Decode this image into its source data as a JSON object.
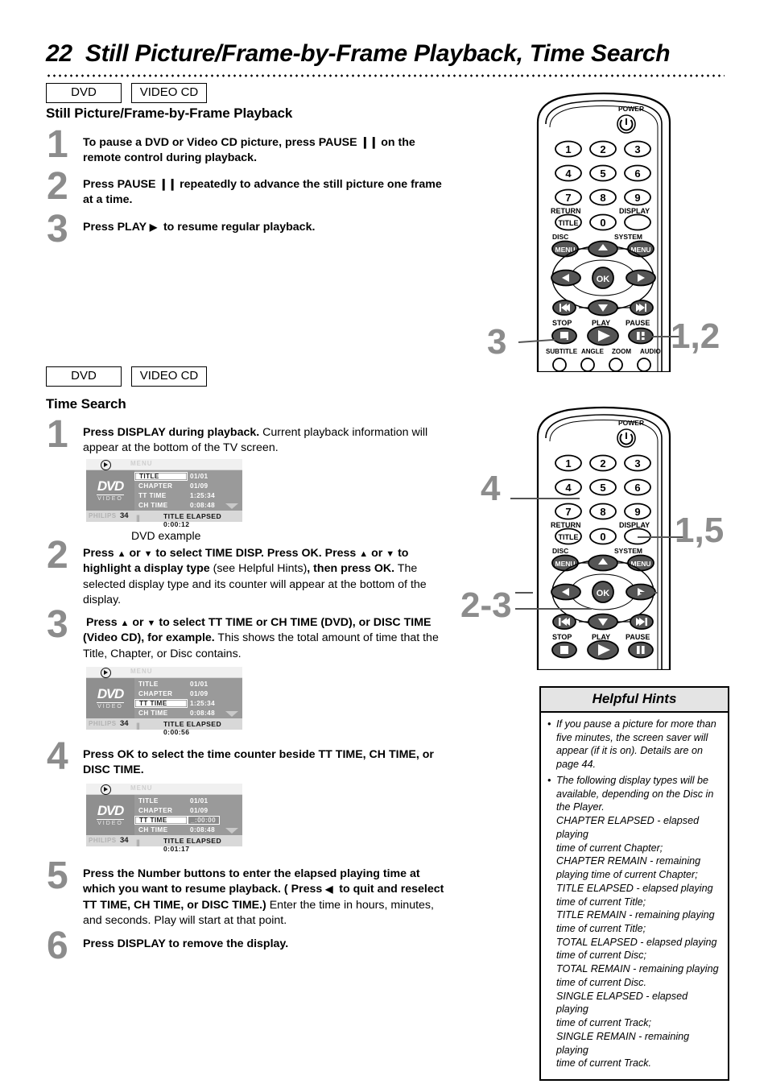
{
  "header": {
    "page_number": "22",
    "title": "Still Picture/Frame-by-Frame Playback, Time Search"
  },
  "badges": {
    "dvd": "DVD",
    "video_cd": "VIDEO CD"
  },
  "section1": {
    "heading": "Still Picture/Frame-by-Frame Playback",
    "steps": [
      {
        "num": "1",
        "html": "<b>To pause a DVD or Video CD picture, press PAUSE <span class=\"pausebars\">❙❙</span> on the remote control during playback.</b>"
      },
      {
        "num": "2",
        "html": "<b>Press PAUSE <span class=\"pausebars\">❙❙</span> repeatedly to advance the still picture one frame at a time.</b>"
      },
      {
        "num": "3",
        "html": "<b>Press PLAY <span class=\"tri-right\"></span>&nbsp; to resume regular playback.</b>"
      }
    ]
  },
  "section2": {
    "heading": "Time Search",
    "steps": [
      {
        "num": "1",
        "html": "<b>Press DISPLAY during playback.</b> Current playback information will appear at the bottom of the TV screen."
      },
      {
        "num": "2",
        "html": "<b>Press <span class=\"tri-up\"></span> or <span class=\"tri-down\"></span> to select TIME DISP. Press OK. Press <span class=\"tri-up\"></span> or <span class=\"tri-down\"></span> to highlight a display type</b> (see Helpful Hints)<b>, then press OK.</b> The selected display type and its counter will appear at the bottom of the display."
      },
      {
        "num": "3",
        "html": "<b>&nbsp;Press <span class=\"tri-up\"></span> or <span class=\"tri-down\"></span> to select TT TIME or CH TIME (DVD), or DISC TIME (Video CD), for example.</b> This shows the total amount of time that the Title, Chapter, or Disc contains."
      },
      {
        "num": "4",
        "html": "<b>Press OK to select the time counter beside TT TIME, CH TIME, or DISC TIME.</b>"
      },
      {
        "num": "5",
        "html": "<b>Press the Number buttons to enter the elapsed playing time at which you want to resume playback. ( Press <span class=\"tri-left\"></span>&nbsp; to quit and reselect TT TIME, CH TIME, or DISC TIME.)</b> Enter the time in hours, minutes, and seconds. Play will start at that point."
      },
      {
        "num": "6",
        "html": "<b>Press DISPLAY to remove the display.</b>"
      }
    ]
  },
  "osd_caption": "DVD example",
  "osd_screens": [
    {
      "id": "osd-1",
      "menu_label": "MENU",
      "rows": [
        {
          "label": "TITLE",
          "value": "01/01",
          "label_highlighted": true,
          "value_highlighted": false
        },
        {
          "label": "CHAPTER",
          "value": "01/09",
          "label_highlighted": false,
          "value_highlighted": false
        },
        {
          "label": "TT  TIME",
          "value": "1:25:34",
          "label_highlighted": false,
          "value_highlighted": false
        },
        {
          "label": "CH  TIME",
          "value": "0:08:48",
          "label_highlighted": false,
          "value_highlighted": false
        }
      ],
      "brand": "PHILIPS",
      "track": "34",
      "status": "TITLE ELAPSED 0:00:12"
    },
    {
      "id": "osd-2",
      "menu_label": "MENU",
      "rows": [
        {
          "label": "TITLE",
          "value": "01/01",
          "label_highlighted": false,
          "value_highlighted": false
        },
        {
          "label": "CHAPTER",
          "value": "01/09",
          "label_highlighted": false,
          "value_highlighted": false
        },
        {
          "label": "TT  TIME",
          "value": "1:25:34",
          "label_highlighted": true,
          "value_highlighted": false
        },
        {
          "label": "CH  TIME",
          "value": "0:08:48",
          "label_highlighted": false,
          "value_highlighted": false
        }
      ],
      "brand": "PHILIPS",
      "track": "34",
      "status": "TITLE ELAPSED 0:00:56"
    },
    {
      "id": "osd-3",
      "menu_label": "MENU",
      "rows": [
        {
          "label": "TITLE",
          "value": "01/01",
          "label_highlighted": false,
          "value_highlighted": false
        },
        {
          "label": "CHAPTER",
          "value": "01/09",
          "label_highlighted": false,
          "value_highlighted": false
        },
        {
          "label": "TT  TIME",
          "value": "_:00:00",
          "label_highlighted": true,
          "value_highlighted": true
        },
        {
          "label": "CH  TIME",
          "value": "0:08:48",
          "label_highlighted": false,
          "value_highlighted": false
        }
      ],
      "brand": "PHILIPS",
      "track": "34",
      "status": "TITLE ELAPSED 0:01:17"
    }
  ],
  "remote": {
    "power_label": "POWER",
    "numbers": [
      "1",
      "2",
      "3",
      "4",
      "5",
      "6",
      "7",
      "8",
      "9"
    ],
    "zero": "0",
    "return_label": "RETURN",
    "title_label": "TITLE",
    "display_label": "DISPLAY",
    "disc_label": "DISC",
    "system_label": "SYSTEM",
    "menu_label": "MENU",
    "ok_label": "OK",
    "stop_label": "STOP",
    "play_label": "PLAY",
    "pause_label": "PAUSE",
    "subtitle_label": "SUBTITLE",
    "angle_label": "ANGLE",
    "zoom_label": "ZOOM",
    "audio_label": "AUDIO"
  },
  "callouts": {
    "remote1_left": "3",
    "remote1_right": "1,2",
    "remote2_left_top": "4",
    "remote2_left_bottom": "2-3",
    "remote2_right": "1,5"
  },
  "hints": {
    "title": "Helpful Hints",
    "items": [
      [
        "If you pause a picture for more than",
        "five minutes, the screen saver will",
        "appear (if it is on). Details are on",
        "page 44."
      ],
      [
        "The following display types will be",
        "available, depending on the Disc in",
        "the Player.",
        "CHAPTER ELAPSED - elapsed playing",
        "time of current Chapter;",
        "CHAPTER REMAIN - remaining",
        "playing time of current Chapter;",
        "TITLE ELAPSED - elapsed playing",
        "time of current Title;",
        "TITLE REMAIN - remaining playing",
        "time of current Title;",
        "TOTAL ELAPSED - elapsed playing",
        "time of current Disc;",
        "TOTAL REMAIN - remaining playing",
        "time of current Disc.",
        "SINGLE ELAPSED - elapsed playing",
        "time of current Track;",
        "SINGLE REMAIN - remaining playing",
        "time of current Track."
      ]
    ]
  },
  "colors": {
    "step_number": "#8c8c8c",
    "callout": "#8c8c8c",
    "osd_panel": "#9a9a9a",
    "hints_title_bg": "#e4e4e4"
  }
}
